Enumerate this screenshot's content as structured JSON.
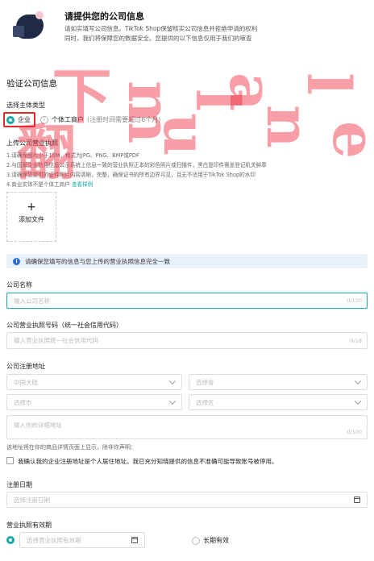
{
  "header": {
    "title": "请提供您的公司信息",
    "subtitle_line1": "请如实填写公司信息。TikTok Shop保留核实公司信息并拒绝申请的权利",
    "subtitle_line2": "同时，我们将保障您的数据安全。您提供的以下信息仅用于我们的审查"
  },
  "section": {
    "title": "验证公司信息"
  },
  "subject_type": {
    "label": "选择主体类型",
    "options": [
      {
        "label": "企业",
        "selected": true
      },
      {
        "label": "个体工商户",
        "hint": "(注册时间需要超过6个月)",
        "selected": false
      }
    ]
  },
  "license_upload": {
    "label": "上传公司营业执照",
    "requirements": [
      "1.请确保图片小于10M，格式为JPG、PNG、BMP或PDF",
      "2.与国家企业信用信息公示系统上信息一致的营业执照正本的彩色照片或扫描件，黑白复印件需盖登记机关鲜章",
      "3.请确保您提供的证件照片内容清晰，完整，确保证书的所有边界可见，且无不适用于TikTok Shop的水印",
      "4.商业实体不是个体工商户"
    ],
    "example_link": "查看样例",
    "add_file": "添加文件",
    "plus": "+"
  },
  "notice": {
    "icon": "i",
    "text": "请确保您填写的信息与您上传的营业执照信息完全一致"
  },
  "company_name": {
    "label": "公司名称",
    "placeholder": "输入公司名称",
    "counter": "0/120"
  },
  "license_number": {
    "label": "公司营业执照号码（统一社会信用代码）",
    "placeholder": "输入营业执照统一社会信用代码",
    "counter": "0/18"
  },
  "address": {
    "label": "公司注册地址",
    "region": "中国大陆",
    "province": "选择省",
    "city": "选择市",
    "district": "选择区",
    "detail_placeholder": "输入你的详细地址",
    "detail_counter": "0/100",
    "note": "该地址将在你的商品详情页面上显示，除非你声明：",
    "checkbox_text": "我确认我的企业注册地址是个人居住地址。我已充分知晓提供的信息不准确可能导致账号被停用。"
  },
  "registration_date": {
    "label": "注册日期",
    "placeholder": "选择注册日期"
  },
  "license_validity": {
    "label": "营业执照有效期",
    "date_placeholder": "选择营业执照有效期",
    "long_term": "长期有效"
  },
  "watermark": {
    "chars": [
      "翻",
      "下",
      "m",
      "u",
      "l",
      "a",
      "n",
      "l",
      "e"
    ]
  },
  "colors": {
    "accent": "#1aa6a6",
    "highlight": "#e02a2a",
    "watermark": "#f0283c"
  }
}
